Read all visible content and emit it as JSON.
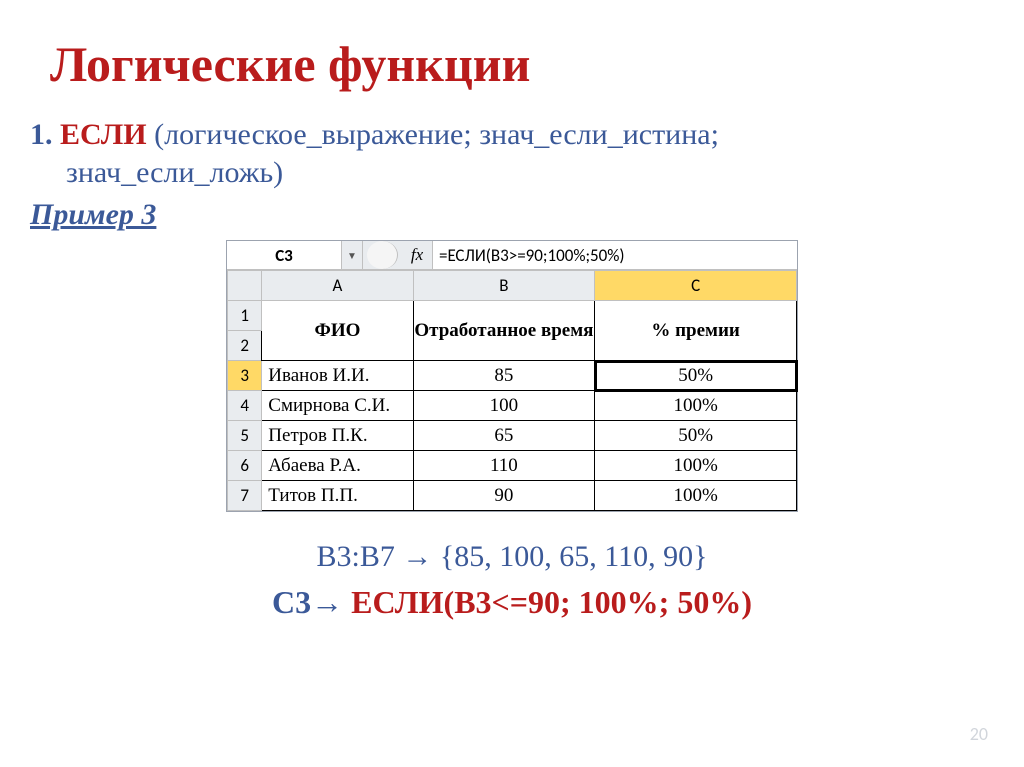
{
  "title": "Логические функции",
  "func": {
    "num": "1.",
    "name": "ЕСЛИ",
    "sig1": " (логическое_выражение; знач_если_истина;",
    "sig2": "знач_если_ложь)"
  },
  "example_label": "Пример 3",
  "excel": {
    "namebox": "C3",
    "fx": "fx",
    "formula": "=ЕСЛИ(B3>=90;100%;50%)",
    "columns": [
      "A",
      "B",
      "C"
    ],
    "header": [
      "ФИО",
      "Отработанное время",
      "% премии"
    ],
    "rows": [
      {
        "n": "3",
        "a": "Иванов И.И.",
        "b": "85",
        "c": "50%"
      },
      {
        "n": "4",
        "a": "Смирнова С.И.",
        "b": "100",
        "c": "100%"
      },
      {
        "n": "5",
        "a": "Петров П.К.",
        "b": "65",
        "c": "50%"
      },
      {
        "n": "6",
        "a": "Абаева Р.А.",
        "b": "110",
        "c": "100%"
      },
      {
        "n": "7",
        "a": "Титов П.П.",
        "b": "90",
        "c": "100%"
      }
    ]
  },
  "range_line": "B3:B7 → {85, 100, 65, 110, 90}",
  "formula_line": {
    "ref": "C3",
    "arrow": "→ ",
    "fn": "ЕСЛИ(B3<=90; 100%; 50%)"
  },
  "page_number": "20"
}
